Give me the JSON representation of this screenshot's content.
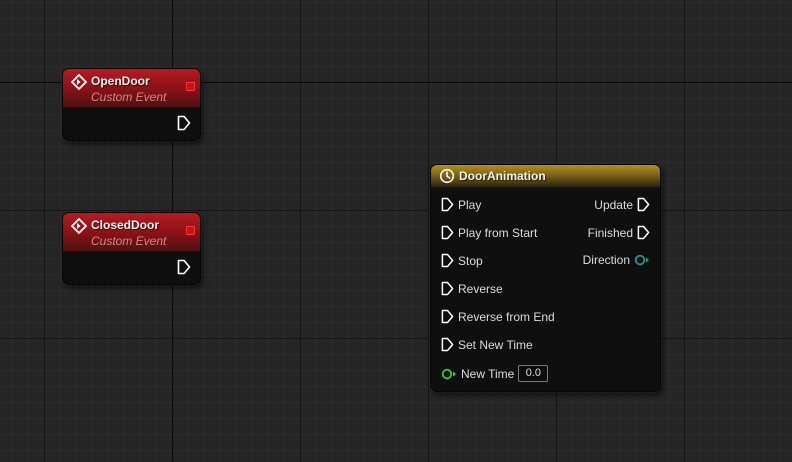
{
  "nodes": {
    "open_door": {
      "title": "OpenDoor",
      "subtitle": "Custom Event"
    },
    "closed_door": {
      "title": "ClosedDoor",
      "subtitle": "Custom Event"
    },
    "door_animation": {
      "title": "DoorAnimation",
      "inputs": [
        {
          "label": "Play",
          "type": "exec"
        },
        {
          "label": "Play from Start",
          "type": "exec"
        },
        {
          "label": "Stop",
          "type": "exec"
        },
        {
          "label": "Reverse",
          "type": "exec"
        },
        {
          "label": "Reverse from End",
          "type": "exec"
        },
        {
          "label": "Set New Time",
          "type": "exec"
        },
        {
          "label": "New Time",
          "type": "float",
          "value": "0.0"
        }
      ],
      "outputs": [
        {
          "label": "Update",
          "type": "exec"
        },
        {
          "label": "Finished",
          "type": "exec"
        },
        {
          "label": "Direction",
          "type": "byte"
        }
      ]
    }
  },
  "colors": {
    "event_header": "#8c1218",
    "timeline_header": "#7d6318",
    "delegate_pin": "#ff3434",
    "float_pin": "#36d92a",
    "byte_pin": "#117a70",
    "exec_pin": "#ffffff"
  },
  "icons": {
    "event": "event-diamond-icon",
    "timeline": "clock-icon",
    "exec": "exec-arrow-icon"
  }
}
